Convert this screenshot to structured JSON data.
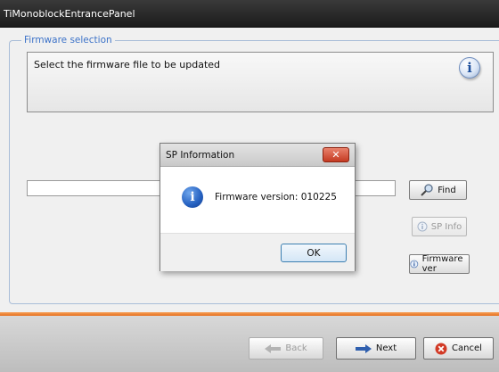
{
  "window": {
    "title": "TiMonoblockEntrancePanel"
  },
  "firmware_selection": {
    "legend": "Firmware selection",
    "instruction": "Select the firmware file to be updated",
    "file_path": ""
  },
  "side_buttons": {
    "find": "Find",
    "sp_info": "SP Info",
    "firmware_ver": "Firmware ver"
  },
  "nav": {
    "back": "Back",
    "next": "Next",
    "cancel": "Cancel"
  },
  "dialog": {
    "title": "SP Information",
    "close_glyph": "✕",
    "message": "Firmware version: 010225",
    "ok": "OK"
  },
  "icons": {
    "info": "info-icon",
    "find": "magnifier-icon",
    "back": "back-arrow-icon",
    "next": "next-arrow-icon",
    "cancel": "cancel-icon"
  },
  "colors": {
    "accent_line": "#e56f1c",
    "legend_text": "#3c72c8",
    "close_button": "#c43a22"
  }
}
